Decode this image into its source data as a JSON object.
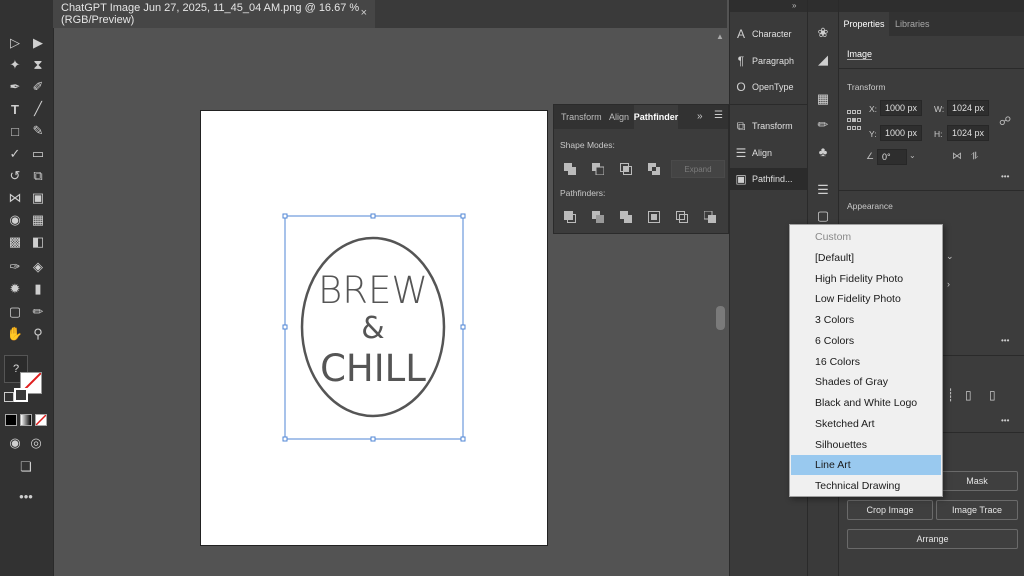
{
  "document": {
    "tab_title": "ChatGPT Image Jun 27, 2025, 11_45_04 AM.png @ 16.67 % (RGB/Preview)",
    "close_glyph": "×"
  },
  "artwork": {
    "line1": "BREW",
    "line2": "&",
    "line3": "CHILL"
  },
  "pathfinder_panel": {
    "tabs": [
      "Transform",
      "Align",
      "Pathfinder"
    ],
    "active_tab": "Pathfinder",
    "shape_modes_label": "Shape Modes:",
    "expand_label": "Expand",
    "pathfinders_label": "Pathfinders:"
  },
  "dock": {
    "items": [
      "Character",
      "Paragraph",
      "OpenType",
      "Transform",
      "Align",
      "Pathfind..."
    ]
  },
  "properties": {
    "tabs": [
      "Properties",
      "Libraries"
    ],
    "active_tab": "Properties",
    "object_type": "Image",
    "transform_label": "Transform",
    "x_label": "X:",
    "x_value": "1000 px",
    "y_label": "Y:",
    "y_value": "1000 px",
    "w_label": "W:",
    "w_value": "1024 px",
    "h_label": "H:",
    "h_value": "1024 px",
    "angle_value": "0°",
    "appearance_label": "Appearance",
    "mask_label": "Mask",
    "crop_image_label": "Crop Image",
    "image_trace_label": "Image Trace",
    "arrange_label": "Arrange",
    "more_glyph": "•••"
  },
  "trace_dropdown": {
    "items": [
      "Custom",
      "[Default]",
      "High Fidelity Photo",
      "Low Fidelity Photo",
      "3 Colors",
      "6 Colors",
      "16 Colors",
      "Shades of Gray",
      "Black and White Logo",
      "Sketched Art",
      "Silhouettes",
      "Line Art",
      "Technical Drawing"
    ],
    "selected": "Line Art",
    "disabled": "Custom"
  },
  "toolbar": {
    "unknown_glyph": "?",
    "more_glyph": "•••"
  },
  "colors": {
    "selection_blue": "#4f86d6",
    "highlight": "#99c9ef",
    "artwork_stroke": "#555555"
  }
}
